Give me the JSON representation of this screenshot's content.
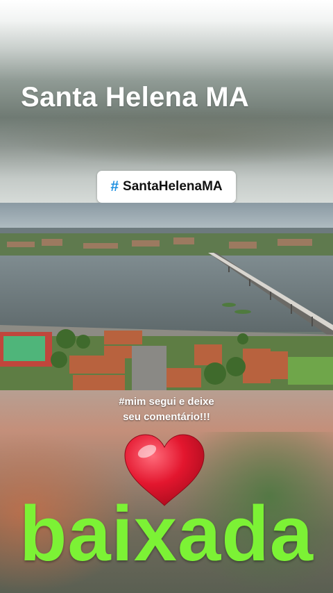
{
  "story": {
    "title": "Santa Helena MA",
    "hashtag_sticker": {
      "icon": "hash-icon",
      "text": "SantaHelenaMA"
    },
    "caption_line1": "#mim  segui e deixe",
    "caption_line2": "seu comentário!!!",
    "heart_sticker": {
      "icon": "heart-icon",
      "color": "#e3162e"
    },
    "big_word": "baixada"
  },
  "colors": {
    "accent_blue": "#1c8fe0",
    "big_word_green": "#7cf235"
  }
}
